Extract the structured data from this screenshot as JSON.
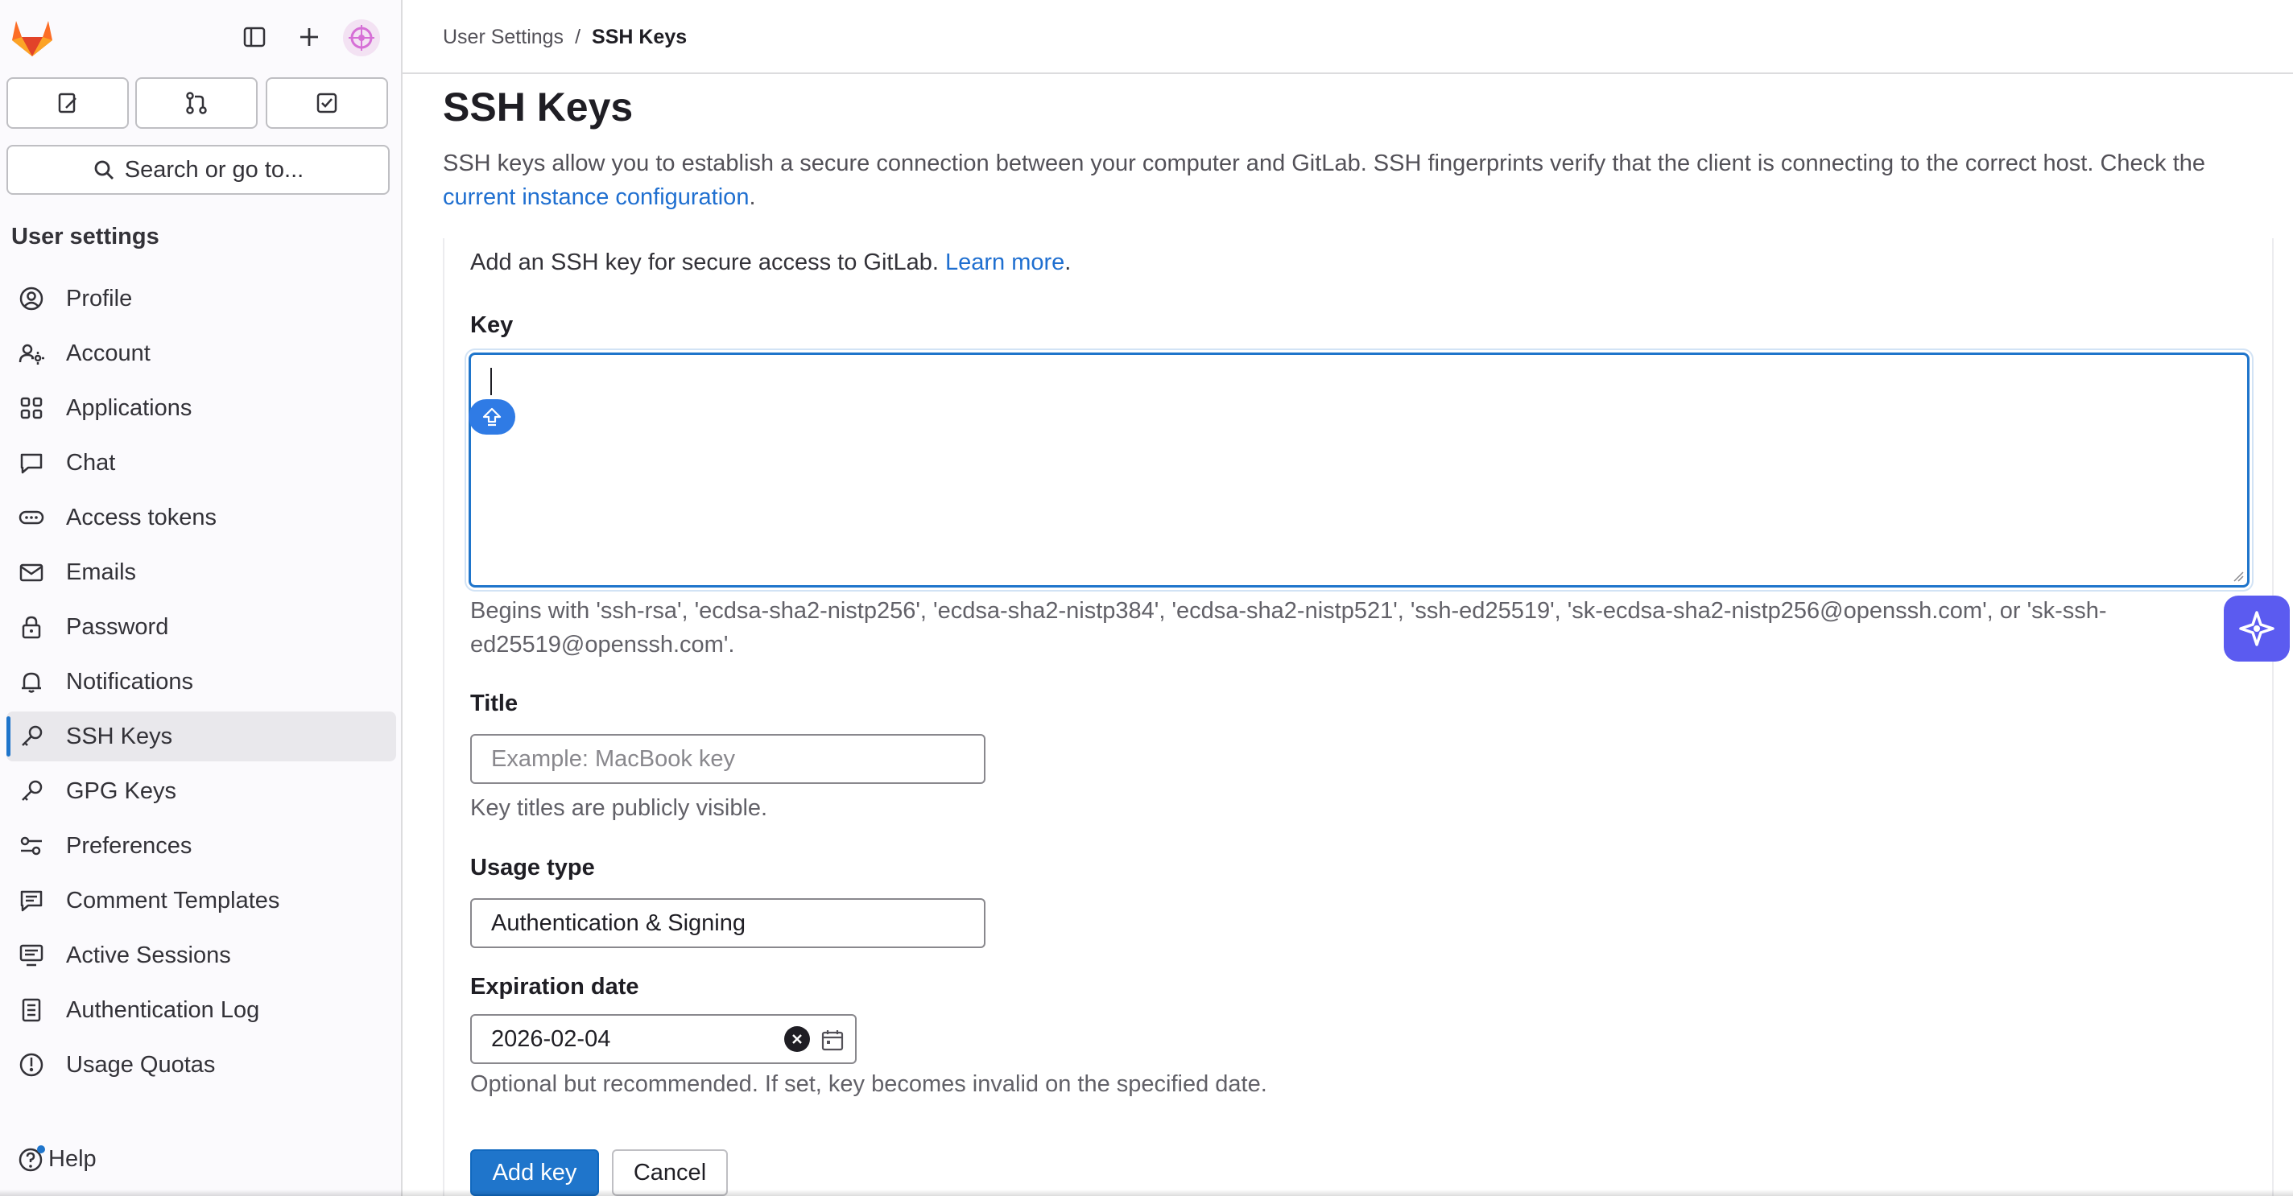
{
  "sidebar": {
    "section_title": "User settings",
    "search_label": "Search or go to...",
    "shortcuts": [
      {
        "icon": "issues-icon"
      },
      {
        "icon": "merge-request-icon"
      },
      {
        "icon": "todo-icon"
      }
    ],
    "items": [
      {
        "label": "Profile",
        "icon": "profile-icon"
      },
      {
        "label": "Account",
        "icon": "account-icon"
      },
      {
        "label": "Applications",
        "icon": "applications-icon"
      },
      {
        "label": "Chat",
        "icon": "chat-icon"
      },
      {
        "label": "Access tokens",
        "icon": "token-icon"
      },
      {
        "label": "Emails",
        "icon": "mail-icon"
      },
      {
        "label": "Password",
        "icon": "lock-icon"
      },
      {
        "label": "Notifications",
        "icon": "bell-icon"
      },
      {
        "label": "SSH Keys",
        "icon": "key-icon"
      },
      {
        "label": "GPG Keys",
        "icon": "key-icon"
      },
      {
        "label": "Preferences",
        "icon": "preferences-icon"
      },
      {
        "label": "Comment Templates",
        "icon": "comment-icon"
      },
      {
        "label": "Active Sessions",
        "icon": "monitor-icon"
      },
      {
        "label": "Authentication Log",
        "icon": "log-icon"
      },
      {
        "label": "Usage Quotas",
        "icon": "quota-icon"
      }
    ],
    "active_item": "SSH Keys",
    "help_label": "Help"
  },
  "breadcrumb": {
    "parent": "User Settings",
    "separator": "/",
    "current": "SSH Keys"
  },
  "page": {
    "title": "SSH Keys",
    "intro_text": "SSH keys allow you to establish a secure connection between your computer and GitLab. SSH fingerprints verify that the client is connecting to the correct host. Check the ",
    "intro_link": "current instance configuration",
    "intro_end": "."
  },
  "form": {
    "add_text": "Add an SSH key for secure access to GitLab. ",
    "learn_more": "Learn more",
    "add_text_end": ".",
    "key_label": "Key",
    "key_value": "",
    "key_help": "Begins with 'ssh-rsa', 'ecdsa-sha2-nistp256', 'ecdsa-sha2-nistp384', 'ecdsa-sha2-nistp521', 'ssh-ed25519', 'sk-ecdsa-sha2-nistp256@openssh.com', or 'sk-ssh-ed25519@openssh.com'.",
    "title_label": "Title",
    "title_placeholder": "Example: MacBook key",
    "title_help": "Key titles are publicly visible.",
    "usage_label": "Usage type",
    "usage_value": "Authentication & Signing",
    "expiration_label": "Expiration date",
    "expiration_value": "2026-02-04",
    "expiration_help": "Optional but recommended. If set, key becomes invalid on the specified date.",
    "submit_label": "Add key",
    "cancel_label": "Cancel"
  },
  "colors": {
    "accent": "#1f75cb",
    "link": "#1f6fd0",
    "brand_orange": "#fc6d26",
    "assistant": "#5b5bf0"
  }
}
